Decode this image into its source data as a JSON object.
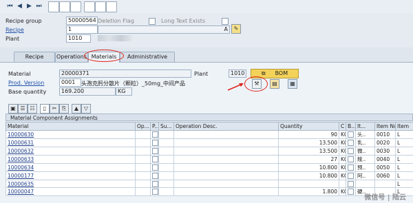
{
  "toolbar": {
    "icons": [
      "first-page-icon",
      "prev-page-icon",
      "next-page-icon",
      "last-page-icon",
      "new-icon",
      "copy-icon",
      "display-icon",
      "assign-icon",
      "cut-icon",
      "where-used-icon"
    ]
  },
  "header": {
    "recipe_group_label": "Recipe group",
    "recipe_group_value": "50000564",
    "deletion_flag_label": "Deletion Flag",
    "long_text_label": "Long Text Exists",
    "recipe_label": "Recipe",
    "recipe_value": "1",
    "recipe_desc_suffix": "A",
    "plant_label": "Plant",
    "plant_value": "1010"
  },
  "tabs": [
    {
      "label": "Recipe Header"
    },
    {
      "label": "Operations"
    },
    {
      "label": "Materials",
      "active": true
    },
    {
      "label": "Administrative Data"
    }
  ],
  "materials": {
    "material_label": "Material",
    "material_value": "20000371",
    "plant_label": "Plant",
    "plant_value": "1010",
    "bom_label": "BOM",
    "prod_version_label": "Prod. Version",
    "prod_version_value": "0001",
    "material_desc": "头孢克肟分散片（颗粒）_50mg_中间产品",
    "base_qty_label": "Base quantity",
    "base_qty_value": "169.200",
    "base_qty_unit": "KG"
  },
  "grid": {
    "title": "Material Component Assignments",
    "columns": [
      "Material",
      "Op...",
      "P...",
      "Su...",
      "Operation Desc.",
      "Quantity",
      "C",
      "B...",
      "It...",
      "Item Nu...",
      "Item"
    ],
    "rows": [
      {
        "material": "10000630",
        "quantity": "90",
        "unit": "KG",
        "desc": "头..",
        "item_no": "0010",
        "item_cat": "L"
      },
      {
        "material": "10000631",
        "quantity": "13.500",
        "unit": "KG",
        "desc": "乳..",
        "item_no": "0020",
        "item_cat": "L"
      },
      {
        "material": "10000632",
        "quantity": "13.500",
        "unit": "KG",
        "desc": "微..",
        "item_no": "0030",
        "item_cat": "L"
      },
      {
        "material": "10000633",
        "quantity": "27",
        "unit": "KG",
        "desc": "羧..",
        "item_no": "0040",
        "item_cat": "L"
      },
      {
        "material": "10000634",
        "quantity": "10.800",
        "unit": "KG",
        "desc": "预..",
        "item_no": "0050",
        "item_cat": "L"
      },
      {
        "material": "10000177",
        "quantity": "10.800",
        "unit": "KG",
        "desc": "阿..",
        "item_no": "0060",
        "item_cat": "L"
      },
      {
        "material": "10000635",
        "quantity": "",
        "unit": "",
        "desc": "",
        "item_no": "",
        "item_cat": "L"
      },
      {
        "material": "10000047",
        "quantity": "1.800",
        "unit": "KG",
        "desc": "硬..",
        "item_no": "",
        "item_cat": "L"
      }
    ]
  },
  "watermark": "微信号 | 陆云"
}
